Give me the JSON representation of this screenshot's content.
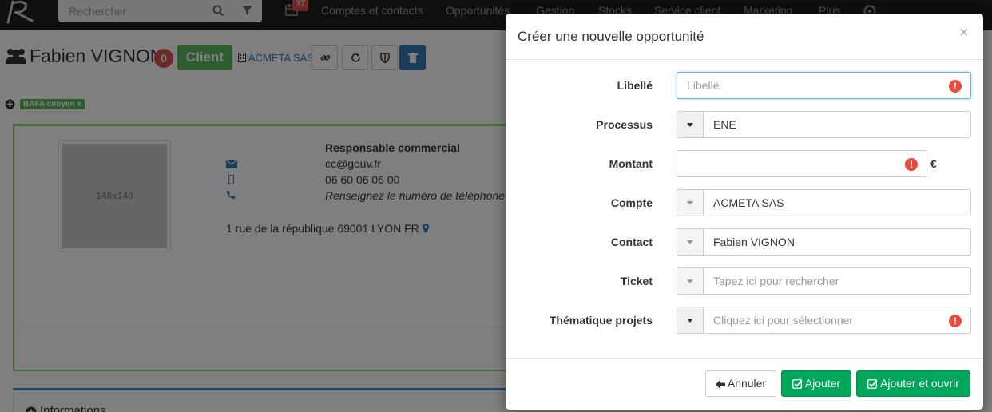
{
  "topnav": {
    "search_placeholder": "Rechercher",
    "calendar_badge": "37",
    "items": [
      "Comptes et contacts",
      "Opportunités",
      "Gestion",
      "Stocks",
      "Service client",
      "Marketing",
      "Plus"
    ]
  },
  "header": {
    "name": "Fabien VIGNON",
    "badge_count": "0",
    "status": "Client",
    "account_link": "ACMETA SAS"
  },
  "tags": [
    "BAFA citoyen x"
  ],
  "contact_card": {
    "photo_placeholder": "140x140",
    "role": "Responsable commercial",
    "email": "cc@gouv.fr",
    "mobile": "06 60 06 06 00",
    "phone_hint": "Renseignez le numéro de téléphone",
    "address": "1 rue de la république 69001 LYON FR"
  },
  "info_panel": {
    "title": "Informations"
  },
  "modal": {
    "title": "Créer une nouvelle opportunité",
    "close": "×",
    "fields": {
      "libelle": {
        "label": "Libellé",
        "placeholder": "Libellé",
        "value": ""
      },
      "processus": {
        "label": "Processus",
        "value": "ENE"
      },
      "montant": {
        "label": "Montant",
        "value": "",
        "currency": "€"
      },
      "compte": {
        "label": "Compte",
        "value": "ACMETA SAS"
      },
      "contact": {
        "label": "Contact",
        "value": "Fabien VIGNON"
      },
      "ticket": {
        "label": "Ticket",
        "placeholder": "Tapez ici pour rechercher"
      },
      "thematique": {
        "label": "Thématique projets",
        "placeholder": "Cliquez ici pour sélectionner"
      }
    },
    "buttons": {
      "cancel": "Annuler",
      "add": "Ajouter",
      "add_open": "Ajouter et ouvrir"
    }
  },
  "colors": {
    "success": "#00a65a",
    "danger": "#d9534f",
    "client_green": "#5cb85c",
    "primary": "#337ab7"
  }
}
